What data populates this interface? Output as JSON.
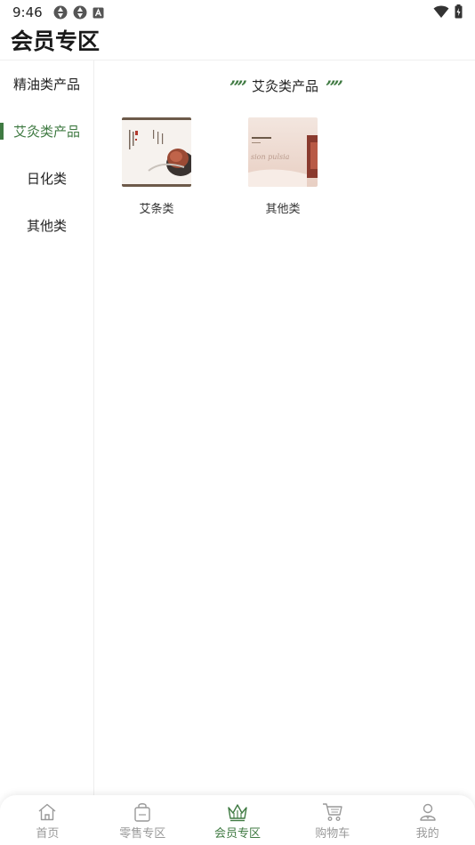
{
  "status": {
    "time": "9:46"
  },
  "header": {
    "title": "会员专区"
  },
  "sidebar": {
    "items": [
      {
        "label": "精油类产品",
        "active": false
      },
      {
        "label": "艾灸类产品",
        "active": true
      },
      {
        "label": "日化类",
        "active": false
      },
      {
        "label": "其他类",
        "active": false
      }
    ]
  },
  "content": {
    "section_title": "艾灸类产品",
    "quote_mark": "””",
    "products": [
      {
        "label": "艾条类"
      },
      {
        "label": "其他类",
        "img_text": "sion pulsia"
      }
    ]
  },
  "tabbar": {
    "items": [
      {
        "label": "首页",
        "icon": "home-icon",
        "active": false
      },
      {
        "label": "零售专区",
        "icon": "shopping-bag-icon",
        "active": false
      },
      {
        "label": "会员专区",
        "icon": "crown-icon",
        "active": true
      },
      {
        "label": "购物车",
        "icon": "cart-icon",
        "active": false
      },
      {
        "label": "我的",
        "icon": "user-icon",
        "active": false
      }
    ]
  },
  "colors": {
    "accent": "#3f7a42",
    "inactive": "#999999"
  }
}
